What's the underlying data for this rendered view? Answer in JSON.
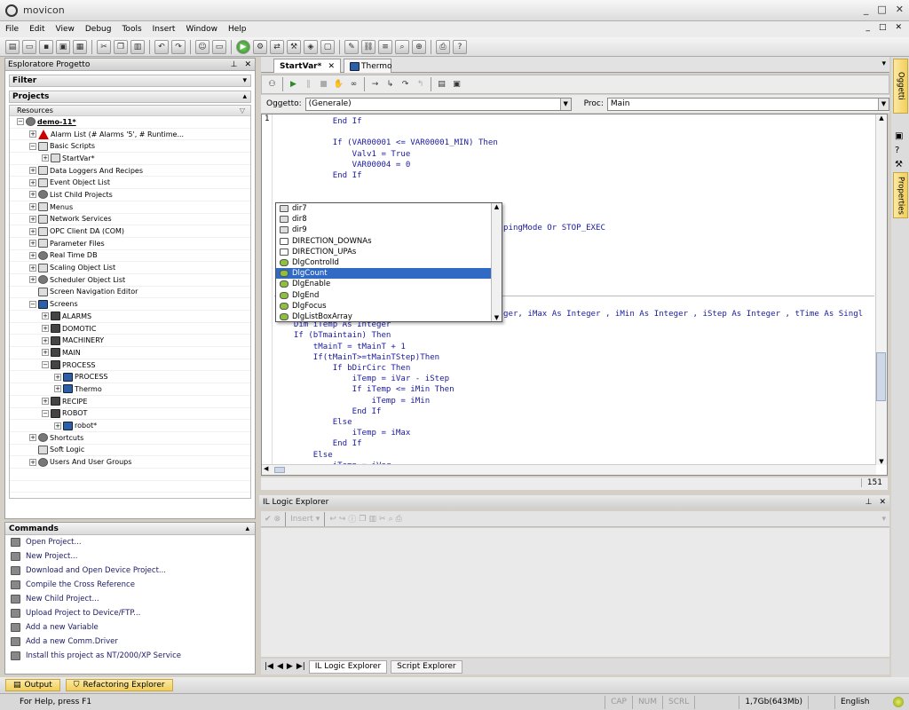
{
  "window": {
    "title": "movicon",
    "min": "_",
    "max": "□",
    "close": "✕"
  },
  "menu": [
    "File",
    "Edit",
    "View",
    "Debug",
    "Tools",
    "Insert",
    "Window",
    "Help"
  ],
  "mdi_buttons": [
    "_",
    "□",
    "✕"
  ],
  "explorer": {
    "title": "Esploratore Progetto",
    "filter_label": "Filter",
    "projects_label": "Projects",
    "resources_label": "Resources",
    "items": [
      {
        "indent": 0,
        "label": "demo-11*",
        "exp": "-",
        "icon": "gear",
        "bold": true
      },
      {
        "indent": 1,
        "label": "Alarm List (# Alarms '5', # Runtime...",
        "exp": "+",
        "icon": "alarm"
      },
      {
        "indent": 1,
        "label": "Basic Scripts",
        "exp": "-",
        "icon": "doc"
      },
      {
        "indent": 2,
        "label": "StartVar*",
        "exp": "+",
        "icon": "doc"
      },
      {
        "indent": 1,
        "label": "Data Loggers And Recipes",
        "exp": "+",
        "icon": "doc"
      },
      {
        "indent": 1,
        "label": "Event Object List",
        "exp": "+",
        "icon": "doc"
      },
      {
        "indent": 1,
        "label": "List Child Projects",
        "exp": "+",
        "icon": "gear"
      },
      {
        "indent": 1,
        "label": "Menus",
        "exp": "+",
        "icon": "doc"
      },
      {
        "indent": 1,
        "label": "Network Services",
        "exp": "+",
        "icon": "doc"
      },
      {
        "indent": 1,
        "label": "OPC Client DA (COM)",
        "exp": "+",
        "icon": "doc"
      },
      {
        "indent": 1,
        "label": "Parameter Files",
        "exp": "+",
        "icon": "doc"
      },
      {
        "indent": 1,
        "label": "Real Time DB",
        "exp": "+",
        "icon": "gear"
      },
      {
        "indent": 1,
        "label": "Scaling Object List",
        "exp": "+",
        "icon": "doc"
      },
      {
        "indent": 1,
        "label": "Scheduler Object List",
        "exp": "+",
        "icon": "gear"
      },
      {
        "indent": 1,
        "label": "Screen Navigation Editor",
        "exp": "",
        "icon": "doc"
      },
      {
        "indent": 1,
        "label": "Screens",
        "exp": "-",
        "icon": "screen"
      },
      {
        "indent": 2,
        "label": "ALARMS",
        "exp": "+",
        "icon": "folder"
      },
      {
        "indent": 2,
        "label": "DOMOTIC",
        "exp": "+",
        "icon": "folder"
      },
      {
        "indent": 2,
        "label": "MACHINERY",
        "exp": "+",
        "icon": "folder"
      },
      {
        "indent": 2,
        "label": "MAIN",
        "exp": "+",
        "icon": "folder"
      },
      {
        "indent": 2,
        "label": "PROCESS",
        "exp": "-",
        "icon": "folder"
      },
      {
        "indent": 3,
        "label": "PROCESS",
        "exp": "+",
        "icon": "screen"
      },
      {
        "indent": 3,
        "label": "Thermo",
        "exp": "+",
        "icon": "screen"
      },
      {
        "indent": 2,
        "label": "RECIPE",
        "exp": "+",
        "icon": "folder"
      },
      {
        "indent": 2,
        "label": "ROBOT",
        "exp": "-",
        "icon": "folder"
      },
      {
        "indent": 3,
        "label": "robot*",
        "exp": "+",
        "icon": "screen"
      },
      {
        "indent": 1,
        "label": "Shortcuts",
        "exp": "+",
        "icon": "gear"
      },
      {
        "indent": 1,
        "label": "Soft Logic",
        "exp": "",
        "icon": "doc"
      },
      {
        "indent": 1,
        "label": "Users And User Groups",
        "exp": "+",
        "icon": "gear"
      }
    ]
  },
  "commands": {
    "title": "Commands",
    "items": [
      "Open Project...",
      "New Project...",
      "Download and Open Device Project...",
      "Compile the Cross Reference",
      "New Child Project...",
      "Upload Project to Device/FTP...",
      "Add a new Variable",
      "Add a new Comm.Driver",
      "Install this project as NT/2000/XP Service"
    ]
  },
  "bottom_tabs": [
    "Output",
    "Refactoring Explorer"
  ],
  "status": {
    "help": "For Help, press F1",
    "cap": "CAP",
    "num": "NUM",
    "scrl": "SCRL",
    "mem": "1,7Gb(643Mb)",
    "lang": "English"
  },
  "doc_tabs": [
    {
      "label": "StartVar*",
      "active": true
    },
    {
      "label": "Thermo",
      "active": false
    }
  ],
  "editor": {
    "oggetto_label": "Oggetto:",
    "oggetto_value": "(Generale)",
    "proc_label": "Proc:",
    "proc_value": "Main",
    "gutter": "1",
    "line_number": "151",
    "lines_top": [
      "            End If",
      "",
      "            If (VAR00001 <= VAR00001_MIN) Then",
      "                Valv1 = True",
      "                VAR00004 = 0",
      "            End If"
    ],
    "line_partial": "pingMode Or STOP_EXEC",
    "lines_bottom": [
      "ger, iMax As Integer , iMin As Integer , iStep As Integer , tTime As Singl",
      "    Dim iTemp As Integer",
      "    If (bTmaintain) Then",
      "        tMainT = tMainT + 1",
      "        If(tMainT>=tMainTStep)Then",
      "            If bDirCirc Then",
      "                iTemp = iVar - iStep",
      "                If iTemp <= iMin Then",
      "                    iTemp = iMin",
      "                End If",
      "            Else",
      "                iTemp = iMax",
      "            End If",
      "        Else",
      "            iTemp = iVar"
    ]
  },
  "autocomplete": [
    {
      "label": "dir7",
      "icon": "prop"
    },
    {
      "label": "dir8",
      "icon": "prop"
    },
    {
      "label": "dir9",
      "icon": "prop"
    },
    {
      "label": "DIRECTION_DOWNAs",
      "icon": "const"
    },
    {
      "label": "DIRECTION_UPAs",
      "icon": "const"
    },
    {
      "label": "DlgControlId",
      "icon": "method"
    },
    {
      "label": "DlgCount",
      "icon": "method",
      "selected": true
    },
    {
      "label": "DlgEnable",
      "icon": "method"
    },
    {
      "label": "DlgEnd",
      "icon": "method"
    },
    {
      "label": "DlgFocus",
      "icon": "method"
    },
    {
      "label": "DlgListBoxArray",
      "icon": "method"
    }
  ],
  "il_logic": {
    "title": "IL Logic Explorer",
    "insert_label": "Insert",
    "tabs": [
      "IL Logic Explorer",
      "Script Explorer"
    ]
  },
  "right_tabs": [
    "Oggetti",
    "Properties"
  ],
  "colors": {
    "accent_tab": "#f2cf5a",
    "code": "#1a1aa0",
    "selection": "#316ac5"
  }
}
